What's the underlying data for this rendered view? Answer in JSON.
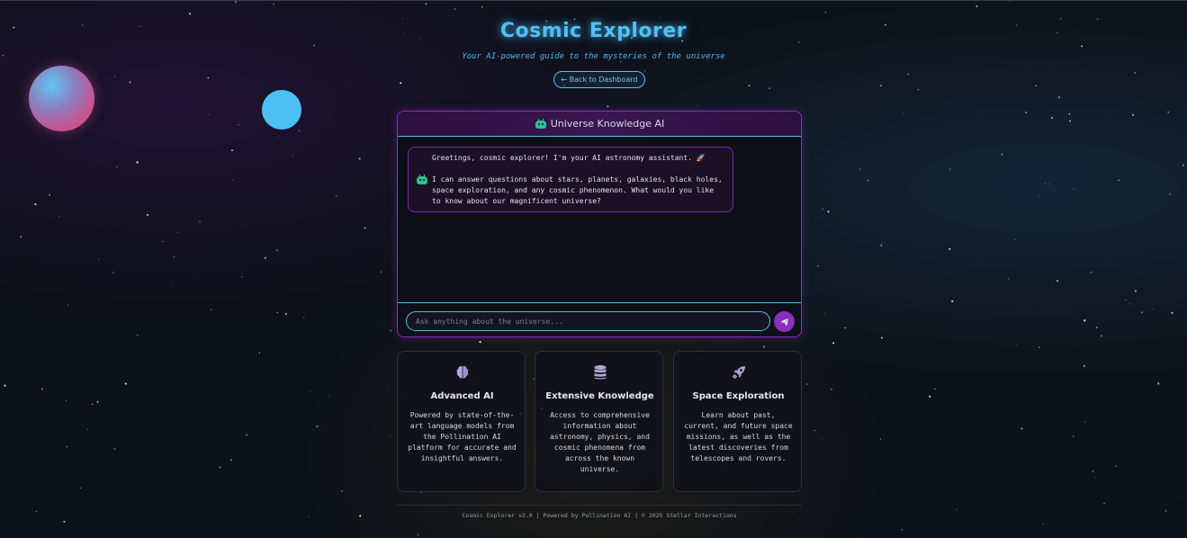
{
  "header": {
    "title": "Cosmic Explorer",
    "subtitle": "Your AI-powered guide to the mysteries of the universe",
    "back_button": "← Back to Dashboard"
  },
  "chat": {
    "title": "Universe Knowledge AI",
    "header_icon": "robot-icon",
    "messages": [
      {
        "sender_icon": "robot-icon",
        "line1": "Greetings, cosmic explorer! I'm your AI astronomy assistant. 🚀",
        "line2": "I can answer questions about stars, planets, galaxies, black holes, space exploration, and any cosmic phenomenon. What would you like to know about our magnificent universe?"
      }
    ],
    "input_placeholder": "Ask anything about the universe...",
    "send_icon": "paper-plane-icon"
  },
  "features": [
    {
      "icon": "brain-icon",
      "title": "Advanced AI",
      "text": "Powered by state-of-the-art language models from the Pollination AI platform for accurate and insightful answers."
    },
    {
      "icon": "database-icon",
      "title": "Extensive Knowledge",
      "text": "Access to comprehensive information about astronomy, physics, and cosmic phenomena from across the known universe."
    },
    {
      "icon": "rocket-icon",
      "title": "Space Exploration",
      "text": "Learn about past, current, and future space missions, as well as the latest discoveries from telescopes and rovers."
    }
  ],
  "footer": {
    "text": "Cosmic Explorer v2.0 | Powered by Pollination AI | © 2025 Stellar Interactions"
  },
  "colors": {
    "accent_cyan": "#4fc0f5",
    "accent_purple": "#8a2ec0",
    "robot_green": "#2ec28f",
    "icon_lavender": "#b6a3da",
    "background": "#0d1119"
  }
}
